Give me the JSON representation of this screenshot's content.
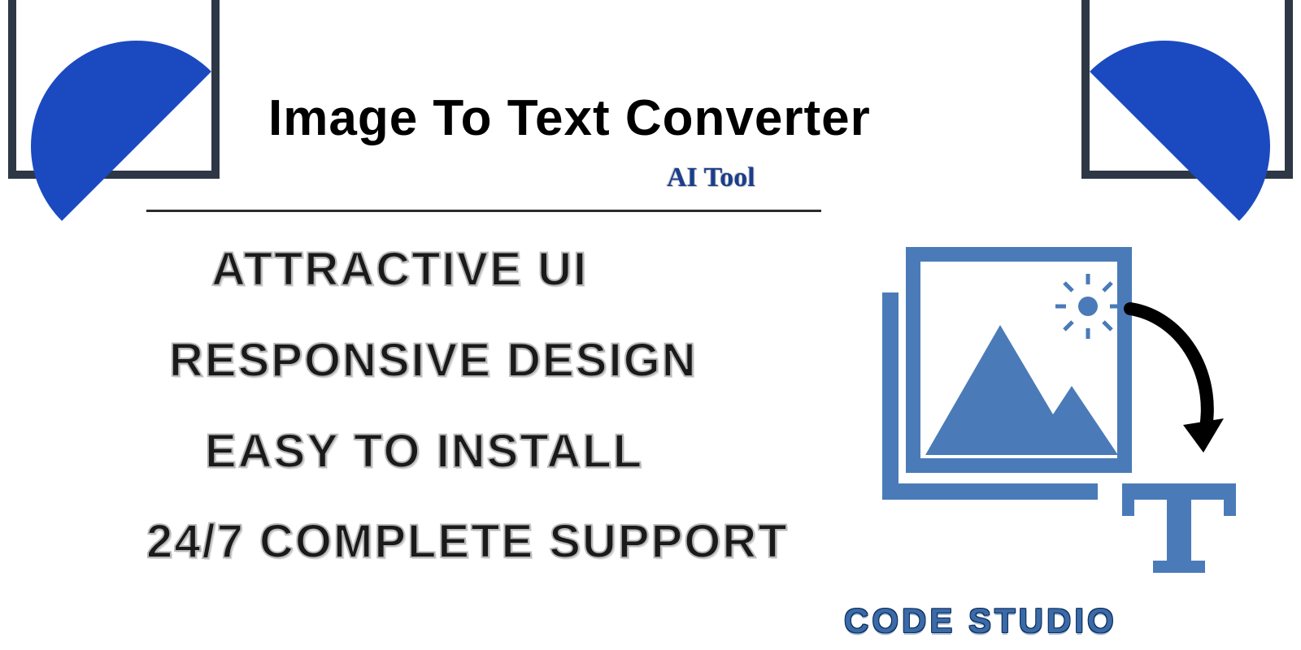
{
  "header": {
    "title": "Image To Text Converter",
    "subtitle": "AI Tool"
  },
  "features": [
    "ATTRACTIVE UI",
    "RESPONSIVE DESIGN",
    "EASY TO INSTALL",
    "24/7 COMPLETE SUPPORT"
  ],
  "brand": "CODE STUDIO",
  "colors": {
    "accent_blue": "#1b4ac0",
    "frame_navy": "#2e3746",
    "icon_blue": "#4a7bb8",
    "brand_blue": "#3a6aa8"
  }
}
